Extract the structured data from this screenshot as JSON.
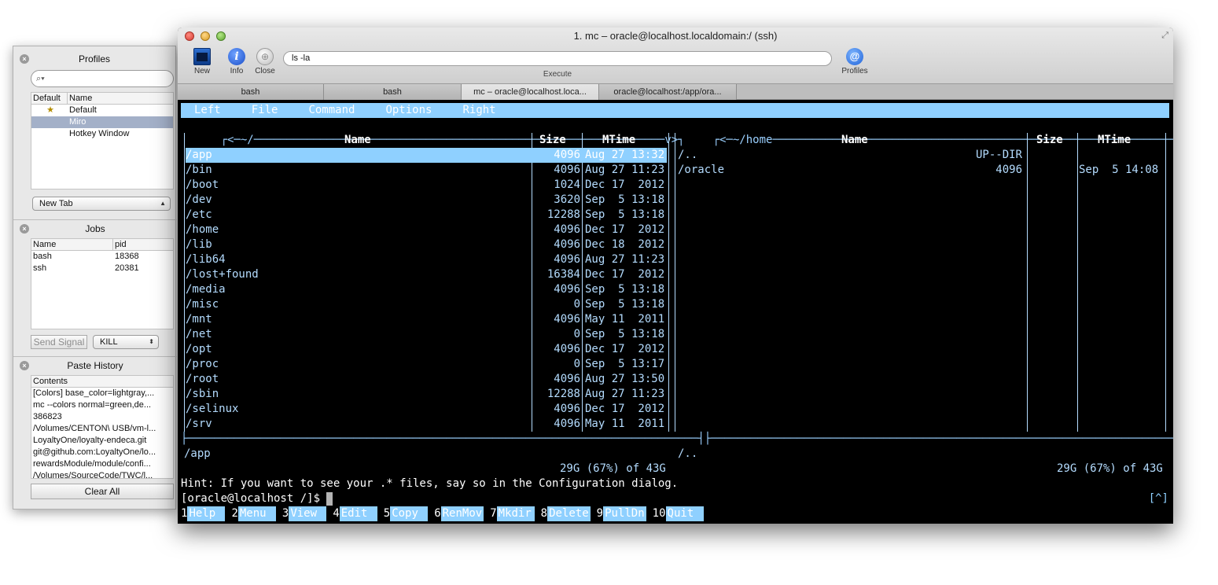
{
  "side": {
    "profiles": {
      "title": "Profiles",
      "search_placeholder": "",
      "cols": [
        "Default",
        "Name"
      ],
      "rows": [
        {
          "default": "★",
          "name": "Default"
        },
        {
          "default": "",
          "name": "Miro"
        },
        {
          "default": "",
          "name": "Hotkey Window"
        }
      ],
      "new_tab": "New Tab"
    },
    "jobs": {
      "title": "Jobs",
      "cols": [
        "Name",
        "pid"
      ],
      "rows": [
        {
          "name": "bash",
          "pid": "18368"
        },
        {
          "name": "ssh",
          "pid": "20381"
        }
      ],
      "send_signal": "Send Signal",
      "signal": "KILL"
    },
    "paste": {
      "title": "Paste History",
      "col": "Contents",
      "items": [
        "[Colors] base_color=lightgray,...",
        "mc --colors normal=green,de...",
        "386823",
        "/Volumes/CENTON\\ USB/vm-l...",
        "LoyaltyOne/loyalty-endeca.git",
        "git@github.com:LoyaltyOne/lo...",
        "rewardsModule/module/confi...",
        "/Volumes/SourceCode/TWC/l..."
      ],
      "clear_all": "Clear All"
    }
  },
  "window": {
    "title": "1. mc – oracle@localhost.localdomain:/ (ssh)",
    "toolbar": {
      "new": "New",
      "info": "Info",
      "close": "Close",
      "command": "ls -la",
      "execute": "Execute",
      "profiles": "Profiles"
    },
    "tabs": [
      "bash",
      "bash",
      "mc – oracle@localhost.loca...",
      "oracle@localhost:/app/ora..."
    ]
  },
  "terminal": {
    "menu": [
      "Left",
      "File",
      "Command",
      "Options",
      "Right"
    ],
    "left": {
      "path": "~/",
      "header": {
        "name": "Name",
        "size": "Size",
        "mtime": "MTime"
      },
      "rows": [
        {
          "name": "/app",
          "size": "4096",
          "mtime": "Aug 27 13:32"
        },
        {
          "name": "/bin",
          "size": "4096",
          "mtime": "Aug 27 11:23"
        },
        {
          "name": "/boot",
          "size": "1024",
          "mtime": "Dec 17  2012"
        },
        {
          "name": "/dev",
          "size": "3620",
          "mtime": "Sep  5 13:18"
        },
        {
          "name": "/etc",
          "size": "12288",
          "mtime": "Sep  5 13:18"
        },
        {
          "name": "/home",
          "size": "4096",
          "mtime": "Dec 17  2012"
        },
        {
          "name": "/lib",
          "size": "4096",
          "mtime": "Dec 18  2012"
        },
        {
          "name": "/lib64",
          "size": "4096",
          "mtime": "Aug 27 11:23"
        },
        {
          "name": "/lost+found",
          "size": "16384",
          "mtime": "Dec 17  2012"
        },
        {
          "name": "/media",
          "size": "4096",
          "mtime": "Sep  5 13:18"
        },
        {
          "name": "/misc",
          "size": "0",
          "mtime": "Sep  5 13:18"
        },
        {
          "name": "/mnt",
          "size": "4096",
          "mtime": "May 11  2011"
        },
        {
          "name": "/net",
          "size": "0",
          "mtime": "Sep  5 13:18"
        },
        {
          "name": "/opt",
          "size": "4096",
          "mtime": "Dec 17  2012"
        },
        {
          "name": "/proc",
          "size": "0",
          "mtime": "Sep  5 13:17"
        },
        {
          "name": "/root",
          "size": "4096",
          "mtime": "Aug 27 13:50"
        },
        {
          "name": "/sbin",
          "size": "12288",
          "mtime": "Aug 27 11:23"
        },
        {
          "name": "/selinux",
          "size": "4096",
          "mtime": "Dec 17  2012"
        },
        {
          "name": "/srv",
          "size": "4096",
          "mtime": "May 11  2011"
        }
      ],
      "selected": "/app",
      "disk": "29G (67%) of 43G"
    },
    "right": {
      "path": "~/home",
      "header": {
        "name": "Name",
        "size": "Size",
        "mtime": "MTime"
      },
      "rows": [
        {
          "name": "/..",
          "size": "UP--DIR",
          "mtime": ""
        },
        {
          "name": "/oracle",
          "size": "4096",
          "mtime": "Sep  5 14:08"
        }
      ],
      "selected": "/..",
      "disk": "29G (67%) of 43G"
    },
    "hint": "Hint: If you want to see your .* files, say so in the Configuration dialog.",
    "prompt": "[oracle@localhost /]$ ",
    "caret_btn": "[^]",
    "fkeys": [
      {
        "n": "1",
        "l": "Help"
      },
      {
        "n": "2",
        "l": "Menu"
      },
      {
        "n": "3",
        "l": "View"
      },
      {
        "n": "4",
        "l": "Edit"
      },
      {
        "n": "5",
        "l": "Copy"
      },
      {
        "n": "6",
        "l": "RenMov"
      },
      {
        "n": "7",
        "l": "Mkdir"
      },
      {
        "n": "8",
        "l": "Delete"
      },
      {
        "n": "9",
        "l": "PullDn"
      },
      {
        "n": "10",
        "l": "Quit"
      }
    ]
  }
}
